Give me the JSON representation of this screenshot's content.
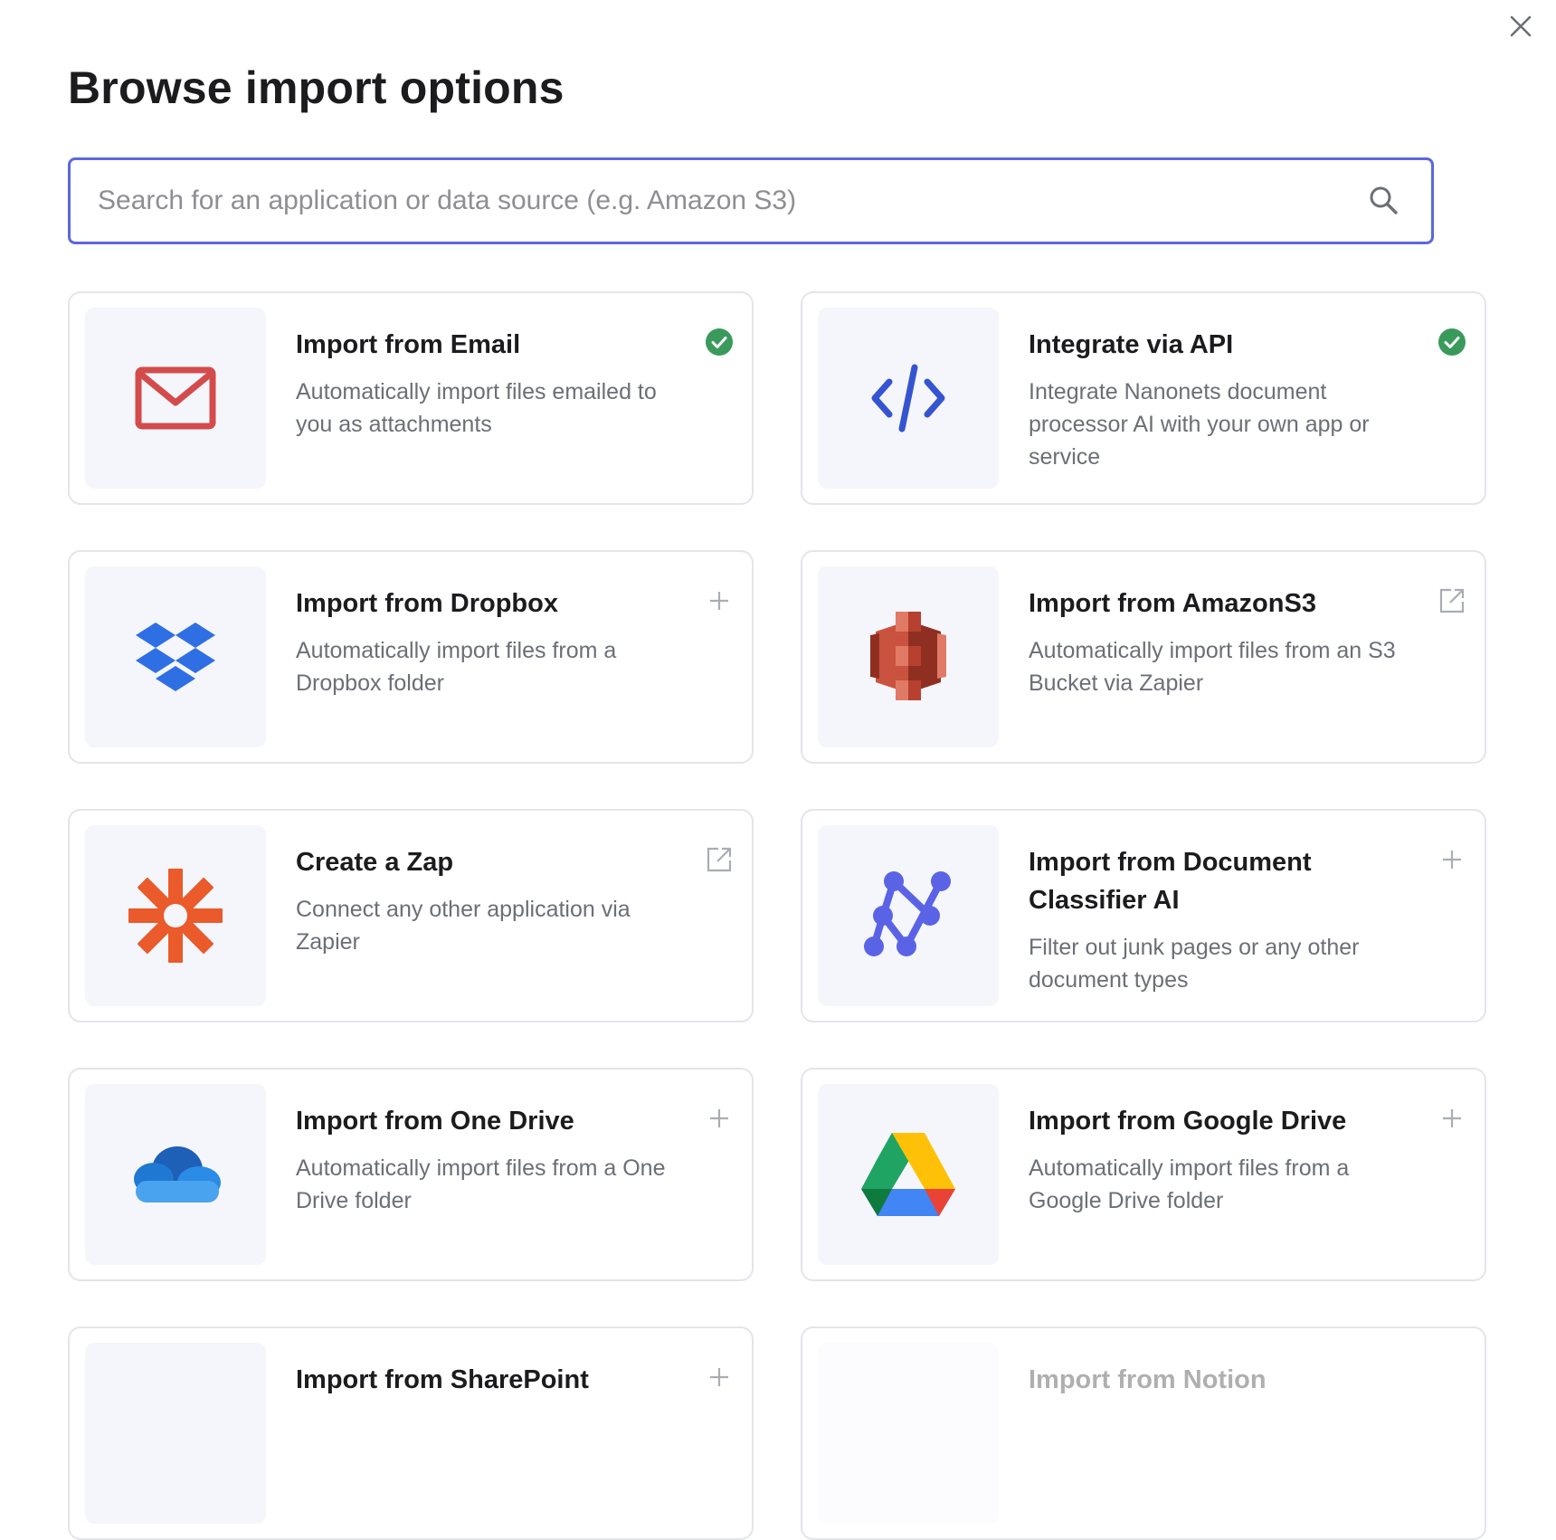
{
  "dialog": {
    "title": "Browse import options",
    "close_icon": "close-icon"
  },
  "search": {
    "placeholder": "Search for an application or data source (e.g. Amazon S3)",
    "value": "",
    "icon": "search-icon"
  },
  "colors": {
    "accent": "#5b67e0",
    "check_green": "#3a9a5c",
    "card_border": "#e3e5ea",
    "icon_bg": "#f5f6fb"
  },
  "options": [
    {
      "title": "Import from Email",
      "description": "Automatically import files emailed to you as attachments",
      "icon": "gmail-icon",
      "status": "enabled-check-icon"
    },
    {
      "title": "Integrate via API",
      "description": "Integrate Nanonets document processor AI with your own app or service",
      "icon": "code-icon",
      "status": "enabled-check-icon"
    },
    {
      "title": "Import from Dropbox",
      "description": "Automatically import files from a Dropbox folder",
      "icon": "dropbox-icon",
      "status": "plus-icon"
    },
    {
      "title": "Import from AmazonS3",
      "description": "Automatically import files from an S3 Bucket via Zapier",
      "icon": "amazon-s3-icon",
      "status": "external-link-icon"
    },
    {
      "title": "Create a Zap",
      "description": "Connect any other application via Zapier",
      "icon": "zapier-icon",
      "status": "external-link-icon"
    },
    {
      "title": "Import from Document Classifier AI",
      "description": "Filter out junk pages or any other document types",
      "icon": "classifier-icon",
      "status": "plus-icon"
    },
    {
      "title": "Import from One Drive",
      "description": "Automatically import files from a One Drive folder",
      "icon": "onedrive-icon",
      "status": "plus-icon"
    },
    {
      "title": "Import from Google Drive",
      "description": "Automatically import files from a Google Drive folder",
      "icon": "google-drive-icon",
      "status": "plus-icon"
    },
    {
      "title": "Import from SharePoint",
      "description": "",
      "icon": "sharepoint-icon",
      "status": "plus-icon"
    },
    {
      "title": "Import from Notion",
      "description": "",
      "icon": "notion-icon",
      "status": ""
    }
  ]
}
